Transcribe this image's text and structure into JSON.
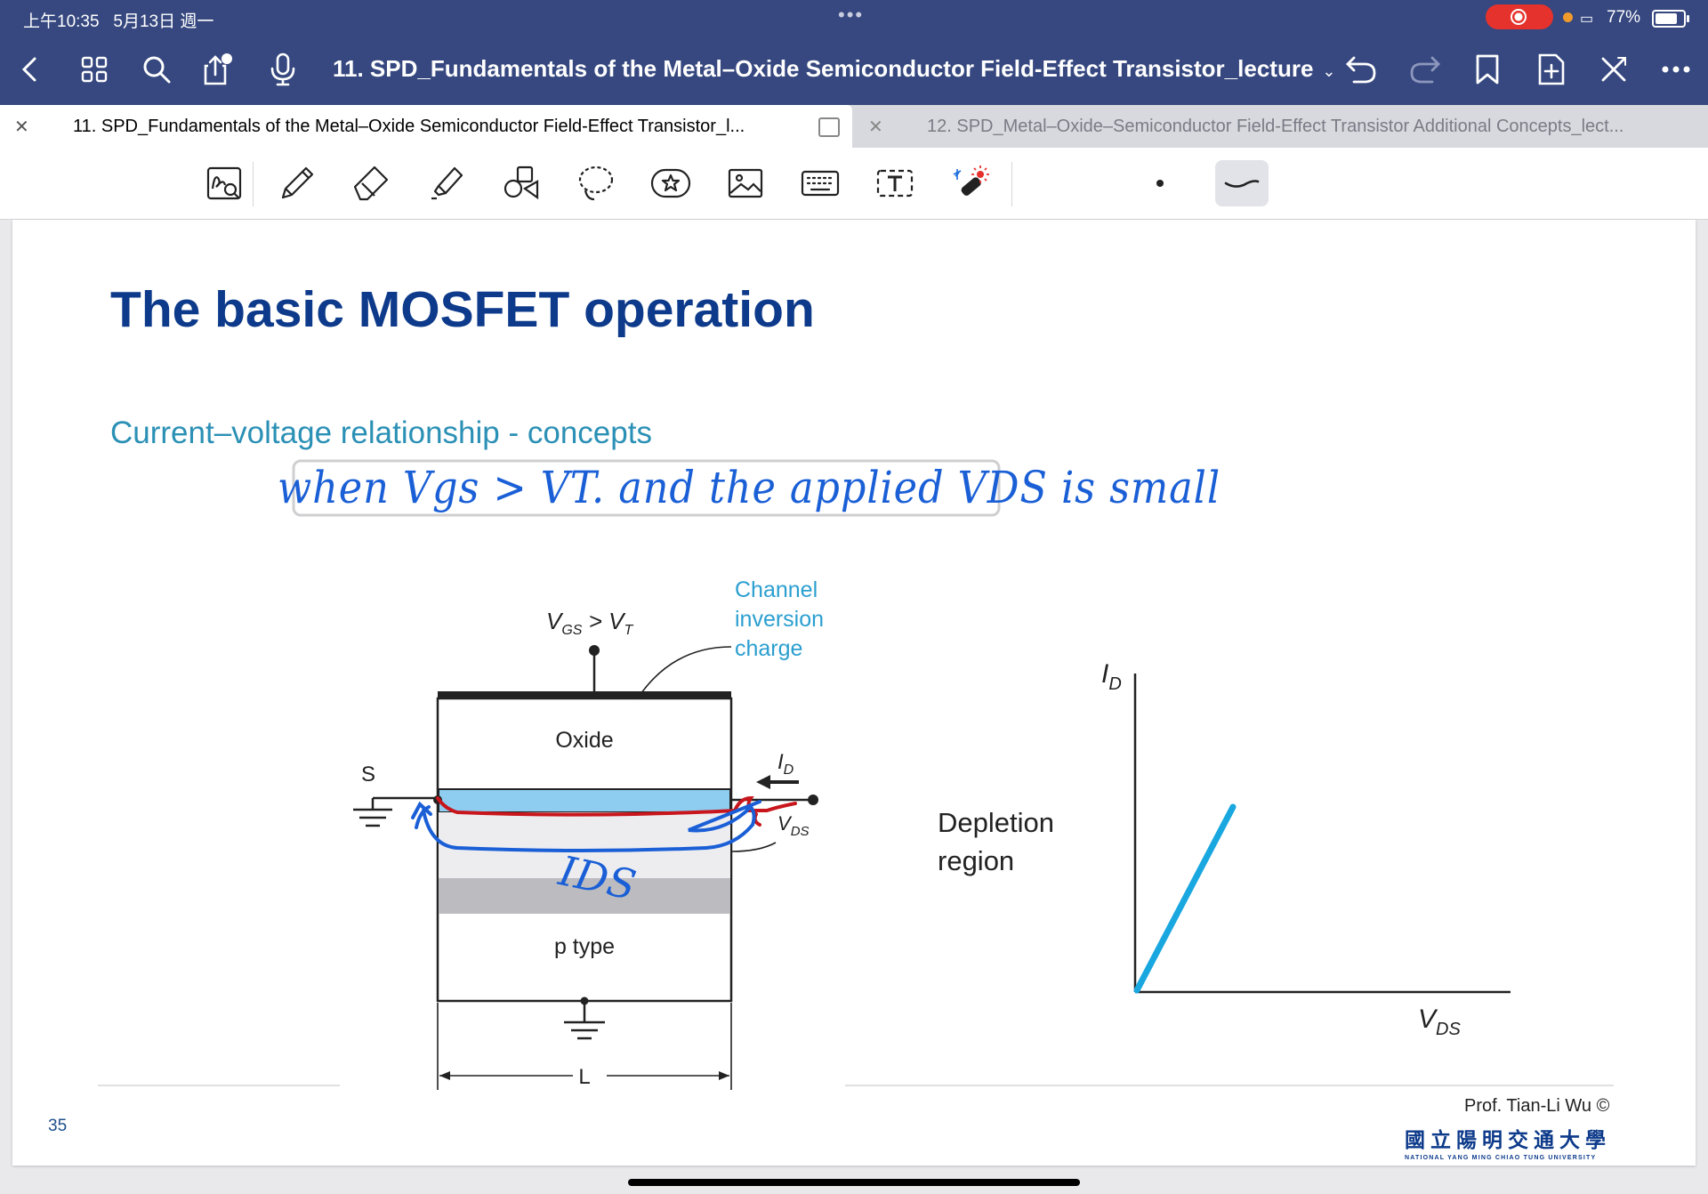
{
  "status_bar": {
    "time": "上午10:35",
    "date": "5月13日 週一",
    "dots": "•••",
    "battery": "77%"
  },
  "nav": {
    "title": "11. SPD_Fundamentals of the Metal–Oxide Semiconductor Field-Effect Transistor_lecture",
    "title_chevron": "⌄"
  },
  "tabs": [
    {
      "label": "11. SPD_Fundamentals of the Metal–Oxide Semiconductor Field-Effect Transistor_l..."
    },
    {
      "label": "12. SPD_Metal–Oxide–Semiconductor Field-Effect Transistor Additional Concepts_lect..."
    }
  ],
  "toolbar": {
    "tools": [
      "zoom-pen-icon",
      "pencil-icon",
      "eraser-icon",
      "highlighter-icon",
      "shapes-icon",
      "lasso-icon",
      "sticker-icon",
      "image-icon",
      "keyboard-icon",
      "textbox-icon",
      "laser-pointer-icon"
    ],
    "selected_style": "curve-stroke"
  },
  "slide": {
    "title": "The basic MOSFET operation",
    "subtitle": "Current–voltage relationship - concepts",
    "handwriting_note": "when Vgs > VT. and the applied VDS is small",
    "handwriting_ids": "IDS",
    "diagram": {
      "vgs_label": "V",
      "vgs_sub": "GS",
      "vgs_rest": " > V",
      "vgs_sub2": "T",
      "channel_label_1": "Channel",
      "channel_label_2": "inversion",
      "channel_label_3": "charge",
      "oxide": "Oxide",
      "source": "S",
      "id_label": "I",
      "id_sub": "D",
      "vds_label": "V",
      "vds_sub": "DS",
      "p_type": "p type",
      "length": "L"
    },
    "plot": {
      "ylabel": "I",
      "ylabel_sub": "D",
      "xlabel": "V",
      "xlabel_sub": "DS",
      "region_line1": "Depletion",
      "region_line2": "region"
    },
    "page_number": "35",
    "credit": "Prof. Tian-Li Wu ©",
    "university_zh": "國立陽明交通大學",
    "university_en": "NATIONAL YANG MING CHIAO TUNG UNIVERSITY"
  },
  "colors": {
    "nav_bg": "#36487f",
    "title_blue": "#0d3a8a",
    "subtitle_teal": "#2b90b5",
    "ink_blue": "#1a5fd6",
    "ink_red": "#c8161c",
    "channel_fill": "#8ecdf0",
    "plot_line": "#19a7e0"
  }
}
